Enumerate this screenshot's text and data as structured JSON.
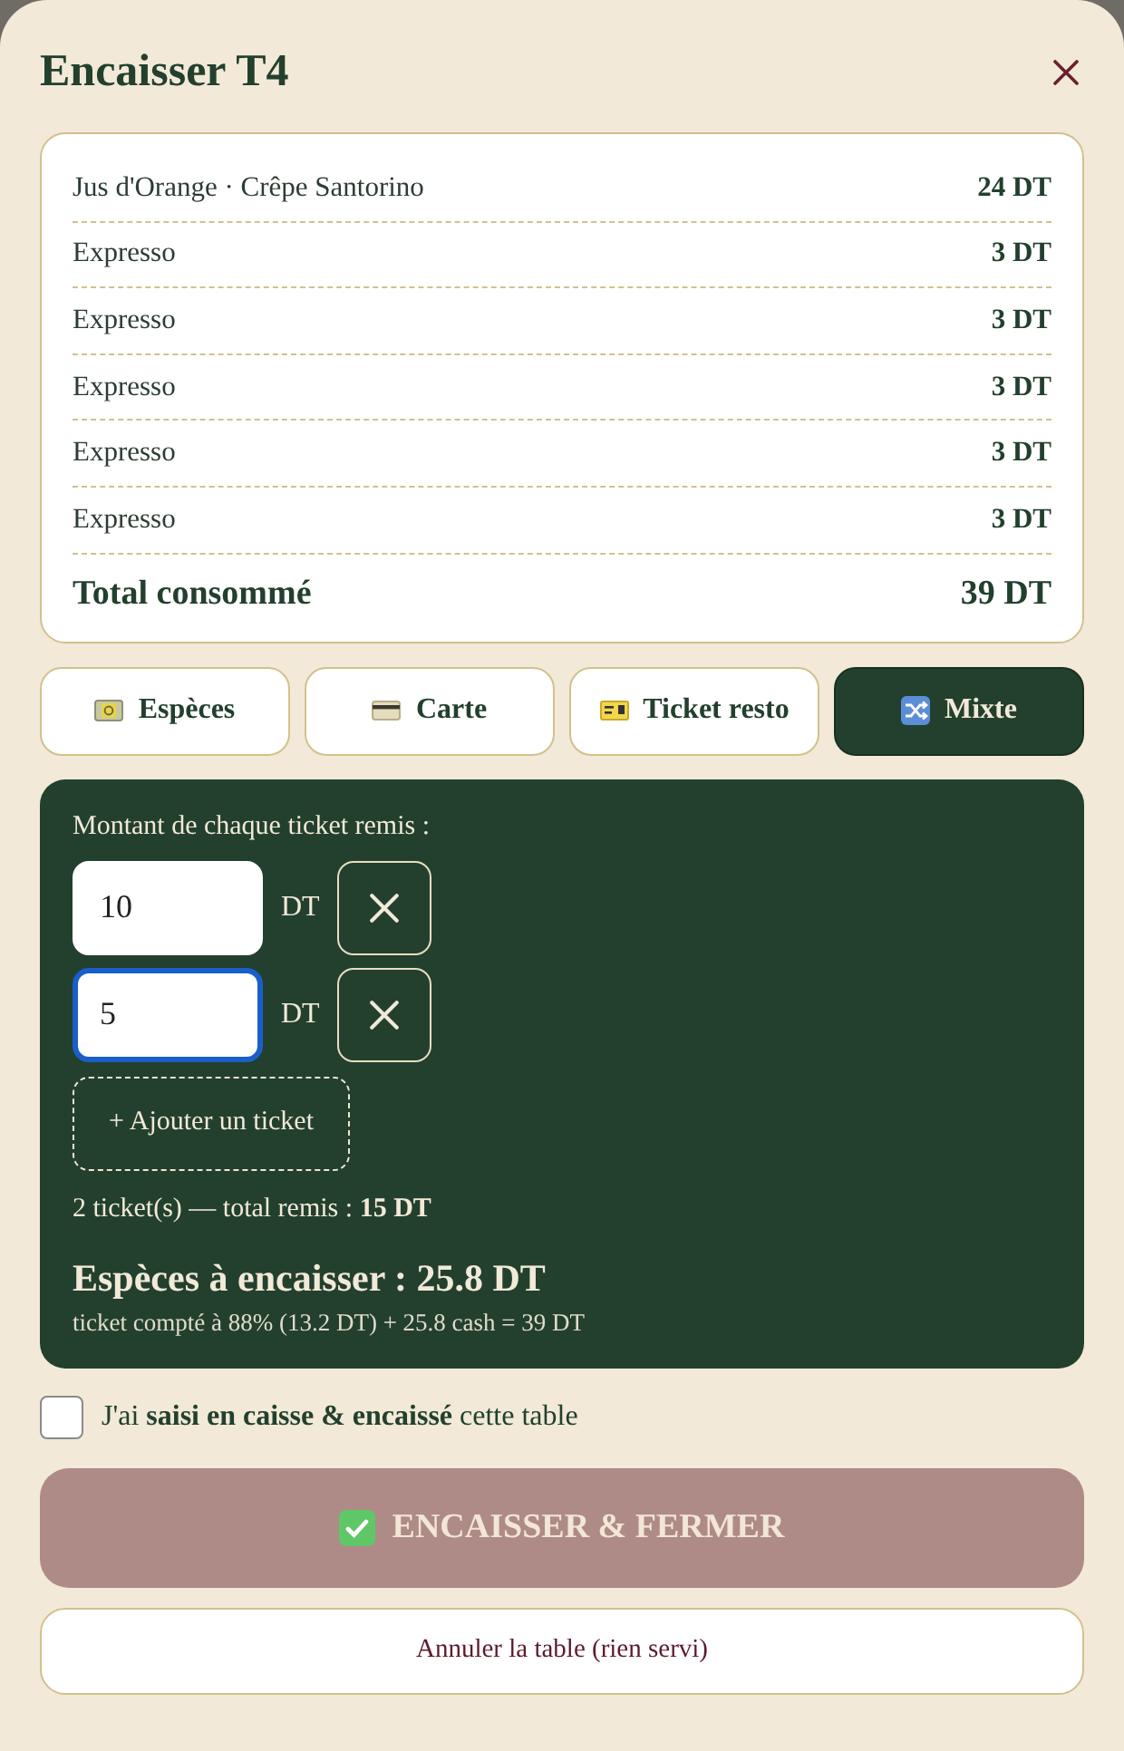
{
  "dialog": {
    "title": "Encaisser T4"
  },
  "order": {
    "items": [
      {
        "name": "Jus d'Orange · Crêpe Santorino",
        "price": "24 DT"
      },
      {
        "name": "Expresso",
        "price": "3 DT"
      },
      {
        "name": "Expresso",
        "price": "3 DT"
      },
      {
        "name": "Expresso",
        "price": "3 DT"
      },
      {
        "name": "Expresso",
        "price": "3 DT"
      },
      {
        "name": "Expresso",
        "price": "3 DT"
      }
    ],
    "total_label": "Total consommé",
    "total": "39 DT"
  },
  "payment_methods": [
    {
      "kind": "cash",
      "label": "Espèces",
      "selected": false
    },
    {
      "kind": "card",
      "label": "Carte",
      "selected": false
    },
    {
      "kind": "ticket",
      "label": "Ticket resto",
      "selected": false
    },
    {
      "kind": "mixed",
      "label": "Mixte",
      "selected": true
    }
  ],
  "tickets_panel": {
    "label": "Montant de chaque ticket remis :",
    "tickets": [
      {
        "value": "10",
        "unit": "DT",
        "focused": false
      },
      {
        "value": "5",
        "unit": "DT",
        "focused": true
      }
    ],
    "add_button": "+ Ajouter un ticket",
    "summary": "2 ticket(s) — total remis : **15 DT**",
    "cash_due": "Espèces à encaisser : 25.8 DT",
    "breakdown": "ticket compté à 88% (13.2 DT) + 25.8 cash = 39 DT"
  },
  "confirm": {
    "label": "J'ai **saisi en caisse & encaissé** cette table",
    "checked": false
  },
  "submit_button": {
    "label": "ENCAISSER & FERMER",
    "disabled": true
  },
  "cancel_button": {
    "label": "Annuler la table (rien servi)"
  }
}
